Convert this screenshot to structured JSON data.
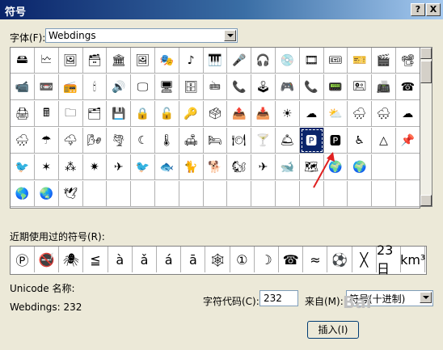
{
  "window": {
    "title": "符号",
    "help_btn": "?",
    "close_btn": "X"
  },
  "font_row": {
    "label": "字体(F):",
    "selected": "Webdings"
  },
  "grid": {
    "rows": [
      [
        "🖴",
        "🗠",
        "🖼",
        "🗃",
        "🏛",
        "🖼",
        "🎭",
        "♪",
        "🎹",
        "🎤",
        "🎧",
        "💿",
        "🎞",
        "🎟",
        "🎫",
        "🎬",
        "📽"
      ],
      [
        "📹",
        "📼",
        "📻",
        "🕯",
        "🔊",
        "🖵",
        "🖥",
        "🗄",
        "🖮",
        "📞",
        "🕹",
        "🎮",
        "📞",
        "📟",
        "🖭",
        "📠",
        "☎"
      ],
      [
        "🖨",
        "🖩",
        "🗀",
        "🗂",
        "💾",
        "🔒",
        "🔓",
        "🔑",
        "🗳",
        "📤",
        "📥",
        "☀",
        "☁",
        "⛅",
        "🌧",
        "🌨",
        "☁"
      ],
      [
        "🌧",
        "☂",
        "🌩",
        "🌬",
        "🌪",
        "☾",
        "🌡",
        "🛋",
        "🛏",
        "🍽",
        "🍸",
        "🛎",
        "🅿",
        "🅿",
        "♿",
        "△",
        "📌"
      ],
      [
        "🐦",
        "✶",
        "⁂",
        "✷",
        "✈",
        "🐦",
        "🐟",
        "🐈",
        "🐕",
        "🐿",
        "✈",
        "🐋",
        "🗺",
        "🌍",
        "🌍",
        "",
        ""
      ],
      [
        "🌎",
        "🌏",
        "🕊",
        "",
        "",
        "",
        "",
        "",
        "",
        "",
        "",
        "",
        "",
        "",
        "",
        "",
        ""
      ]
    ],
    "selected_row": 3,
    "selected_col": 12
  },
  "recent": {
    "label": "近期使用过的符号(R):",
    "symbols": [
      "Ⓟ",
      "🚭",
      "🕷",
      "≦",
      "à",
      "ǎ",
      "á",
      "ā",
      "🕸",
      "①",
      "☽",
      "☎",
      "≈",
      "⚽",
      "╳",
      "23日",
      "km³"
    ]
  },
  "unicode_name": {
    "label": "Unicode 名称:"
  },
  "font_code": {
    "text": "Webdings: 232"
  },
  "char_code": {
    "label": "字符代码(C):",
    "value": "232"
  },
  "from": {
    "label": "来自(M):",
    "value": "符号(十进制)"
  },
  "insert_button": {
    "label": "插入(I)"
  },
  "watermark": {
    "text": "Bai"
  }
}
